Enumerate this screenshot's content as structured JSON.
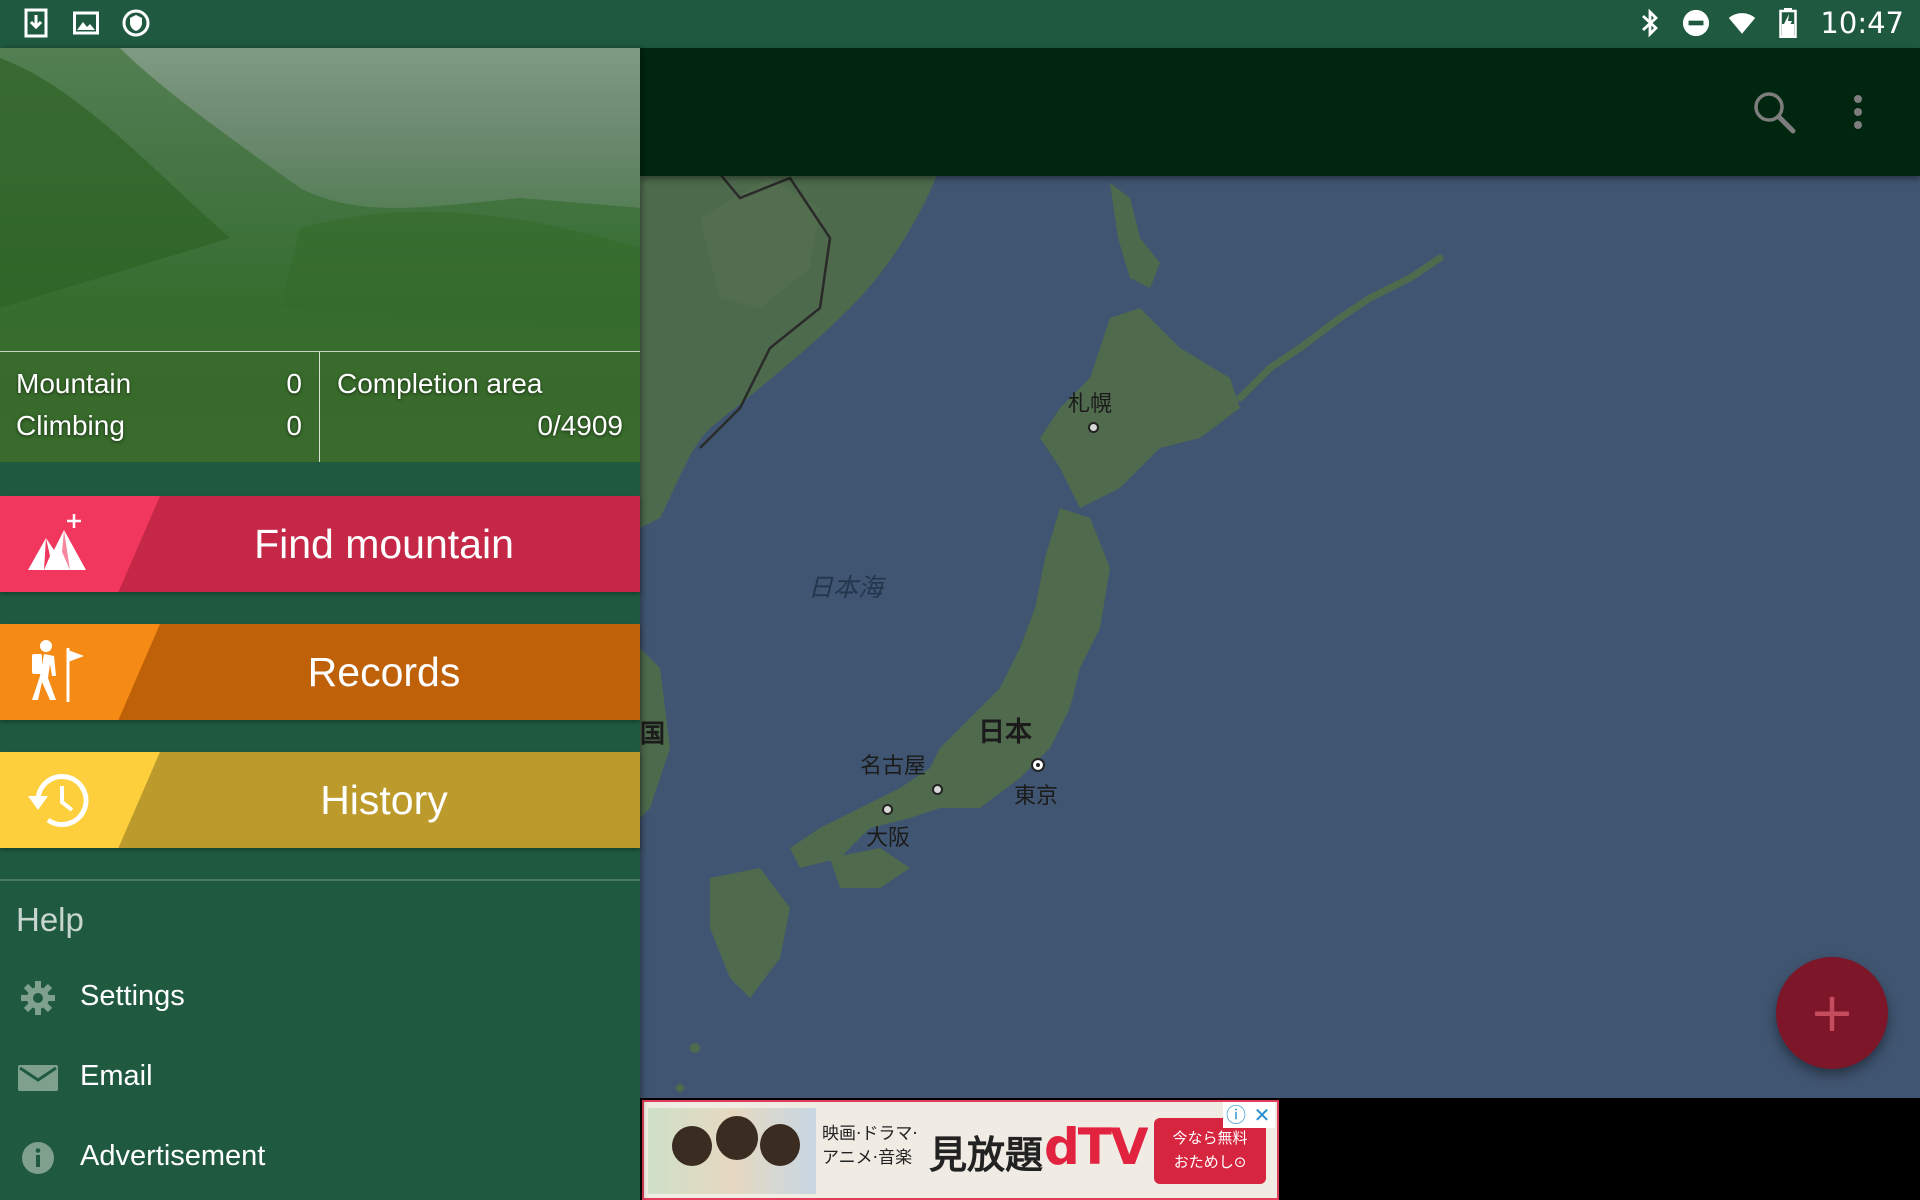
{
  "status_bar": {
    "time": "10:47",
    "left_icons": [
      "download-icon",
      "image-icon",
      "vpn-shield-icon"
    ],
    "right_icons": [
      "bluetooth-icon",
      "do-not-disturb-icon",
      "wifi-icon",
      "battery-charging-icon"
    ]
  },
  "app_bar": {
    "actions": [
      "search-icon",
      "more-vert-icon"
    ]
  },
  "drawer": {
    "stats": {
      "mountain_label": "Mountain",
      "mountain_value": "0",
      "climbing_label": "Climbing",
      "climbing_value": "0",
      "completion_label": "Completion area",
      "completion_value": "0/4909"
    },
    "menu": [
      {
        "label": "Find mountain",
        "icon": "mountain-sparkle-icon",
        "icon_bg": "#f1375d",
        "bar_color": "#c52746"
      },
      {
        "label": "Records",
        "icon": "hiker-icon",
        "icon_bg": "#f58a14",
        "bar_color": "#bf6108"
      },
      {
        "label": "History",
        "icon": "history-icon",
        "icon_bg": "#fdcf3d",
        "bar_color": "#bd9a2c"
      }
    ],
    "section_title": "Help",
    "items": [
      {
        "label": "Settings",
        "icon": "gear-icon"
      },
      {
        "label": "Email",
        "icon": "mail-icon"
      },
      {
        "label": "Advertisement",
        "icon": "info-icon"
      }
    ]
  },
  "map": {
    "labels": {
      "sapporo": "札幌",
      "sea_of_japan": "日本海",
      "japan": "日本",
      "nagoya": "名古屋",
      "tokyo": "東京",
      "osaka": "大阪",
      "korea_partial": "国"
    },
    "colors": {
      "sea": "#405571",
      "land": "#4f6a4c"
    }
  },
  "fab": {
    "label": "+",
    "color": "#7c1628"
  },
  "ad": {
    "line1": "映画·ドラマ·",
    "line2": "アニメ·音楽",
    "headline": "見放題",
    "brand": "dTV",
    "cta1": "今なら無料",
    "cta2": "おためし⊙",
    "info": "ⓘ",
    "close": "✕"
  }
}
